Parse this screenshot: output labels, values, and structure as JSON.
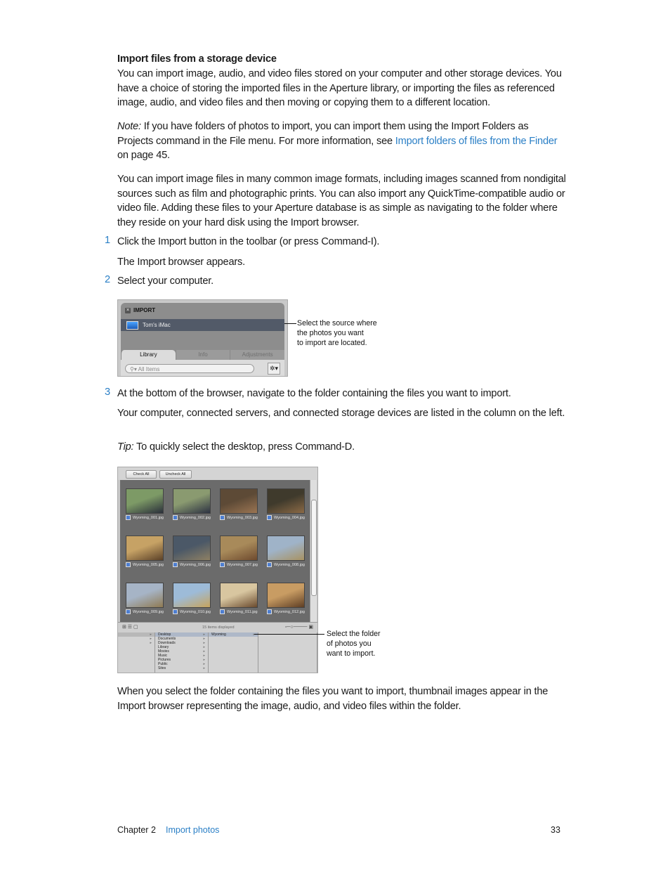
{
  "heading": "Import files from a storage device",
  "para1": "You can import image, audio, and video files stored on your computer and other storage devices. You have a choice of storing the imported files in the Aperture library, or importing the files as referenced image, audio, and video files and then moving or copying them to a different location.",
  "note": {
    "label": "Note:",
    "text1": " If you have folders of photos to import, you can import them using the Import Folders as Projects command in the File menu. For more information, see ",
    "link": "Import folders of files from the Finder",
    "text2": " on page 45."
  },
  "para2": "You can import image files in many common image formats, including images scanned from nondigital sources such as film and photographic prints. You can also import any QuickTime-compatible audio or video file. Adding these files to your Aperture database is as simple as navigating to the folder where they reside on your hard disk using the Import browser.",
  "steps": [
    {
      "num": "1",
      "text": "Click the Import button in the toolbar (or press Command-I).",
      "after": "The Import browser appears."
    },
    {
      "num": "2",
      "text": "Select your computer."
    },
    {
      "num": "3",
      "text": "At the bottom of the browser, navigate to the folder containing the files you want to import.",
      "after": "Your computer, connected servers, and connected storage devices are listed in the column on the left."
    }
  ],
  "tip": {
    "label": "Tip:",
    "text": " To quickly select the desktop, press Command-D."
  },
  "figure1": {
    "title": "IMPORT",
    "source": "Tom's iMac",
    "tabs": [
      "Library",
      "Info",
      "Adjustments"
    ],
    "search_placeholder": "All Items",
    "callout": [
      "Select the source where",
      "the photos you want",
      "to import are located."
    ]
  },
  "figure2": {
    "buttons": [
      "Check All",
      "Uncheck All"
    ],
    "thumbnails": [
      {
        "name": "Wyoming_001.jpg",
        "colors": [
          "#7d9a66",
          "#2a2f3a"
        ]
      },
      {
        "name": "Wyoming_002.jpg",
        "colors": [
          "#8a9a70",
          "#2d3242"
        ]
      },
      {
        "name": "Wyoming_003.jpg",
        "colors": [
          "#5d4a36",
          "#9b7553"
        ]
      },
      {
        "name": "Wyoming_004.jpg",
        "colors": [
          "#3f3a2c",
          "#8c6a46"
        ]
      },
      {
        "name": "Wyoming_005.jpg",
        "colors": [
          "#c6a265",
          "#5b4128"
        ]
      },
      {
        "name": "Wyoming_006.jpg",
        "colors": [
          "#4b5867",
          "#8e8064"
        ]
      },
      {
        "name": "Wyoming_007.jpg",
        "colors": [
          "#a88a5a",
          "#6e4a2e"
        ]
      },
      {
        "name": "Wyoming_008.jpg",
        "colors": [
          "#9fb3c8",
          "#a89262"
        ]
      },
      {
        "name": "Wyoming_009.jpg",
        "colors": [
          "#a6b4c6",
          "#8f7a52"
        ]
      },
      {
        "name": "Wyoming_010.jpg",
        "colors": [
          "#9dbbd8",
          "#c7a45c"
        ]
      },
      {
        "name": "Wyoming_011.jpg",
        "colors": [
          "#d8c6a0",
          "#6a4a2e"
        ]
      },
      {
        "name": "Wyoming_012.jpg",
        "colors": [
          "#c89c63",
          "#5e3e24"
        ]
      }
    ],
    "status": "15 items displayed",
    "col1": [
      "",
      "",
      ""
    ],
    "col2": [
      "Desktop",
      "Documents",
      "Downloads",
      "Library",
      "Movies",
      "Music",
      "Pictures",
      "Public",
      "Sites"
    ],
    "col3": [
      "Wyoming"
    ],
    "callout": [
      "Select the folder",
      "of photos you",
      "want to import."
    ]
  },
  "closing": "When you select the folder containing the files you want to import, thumbnail images appear in the Import browser representing the image, audio, and video files within the folder.",
  "footer": {
    "chapter": "Chapter 2",
    "section": "Import photos",
    "page": "33"
  }
}
